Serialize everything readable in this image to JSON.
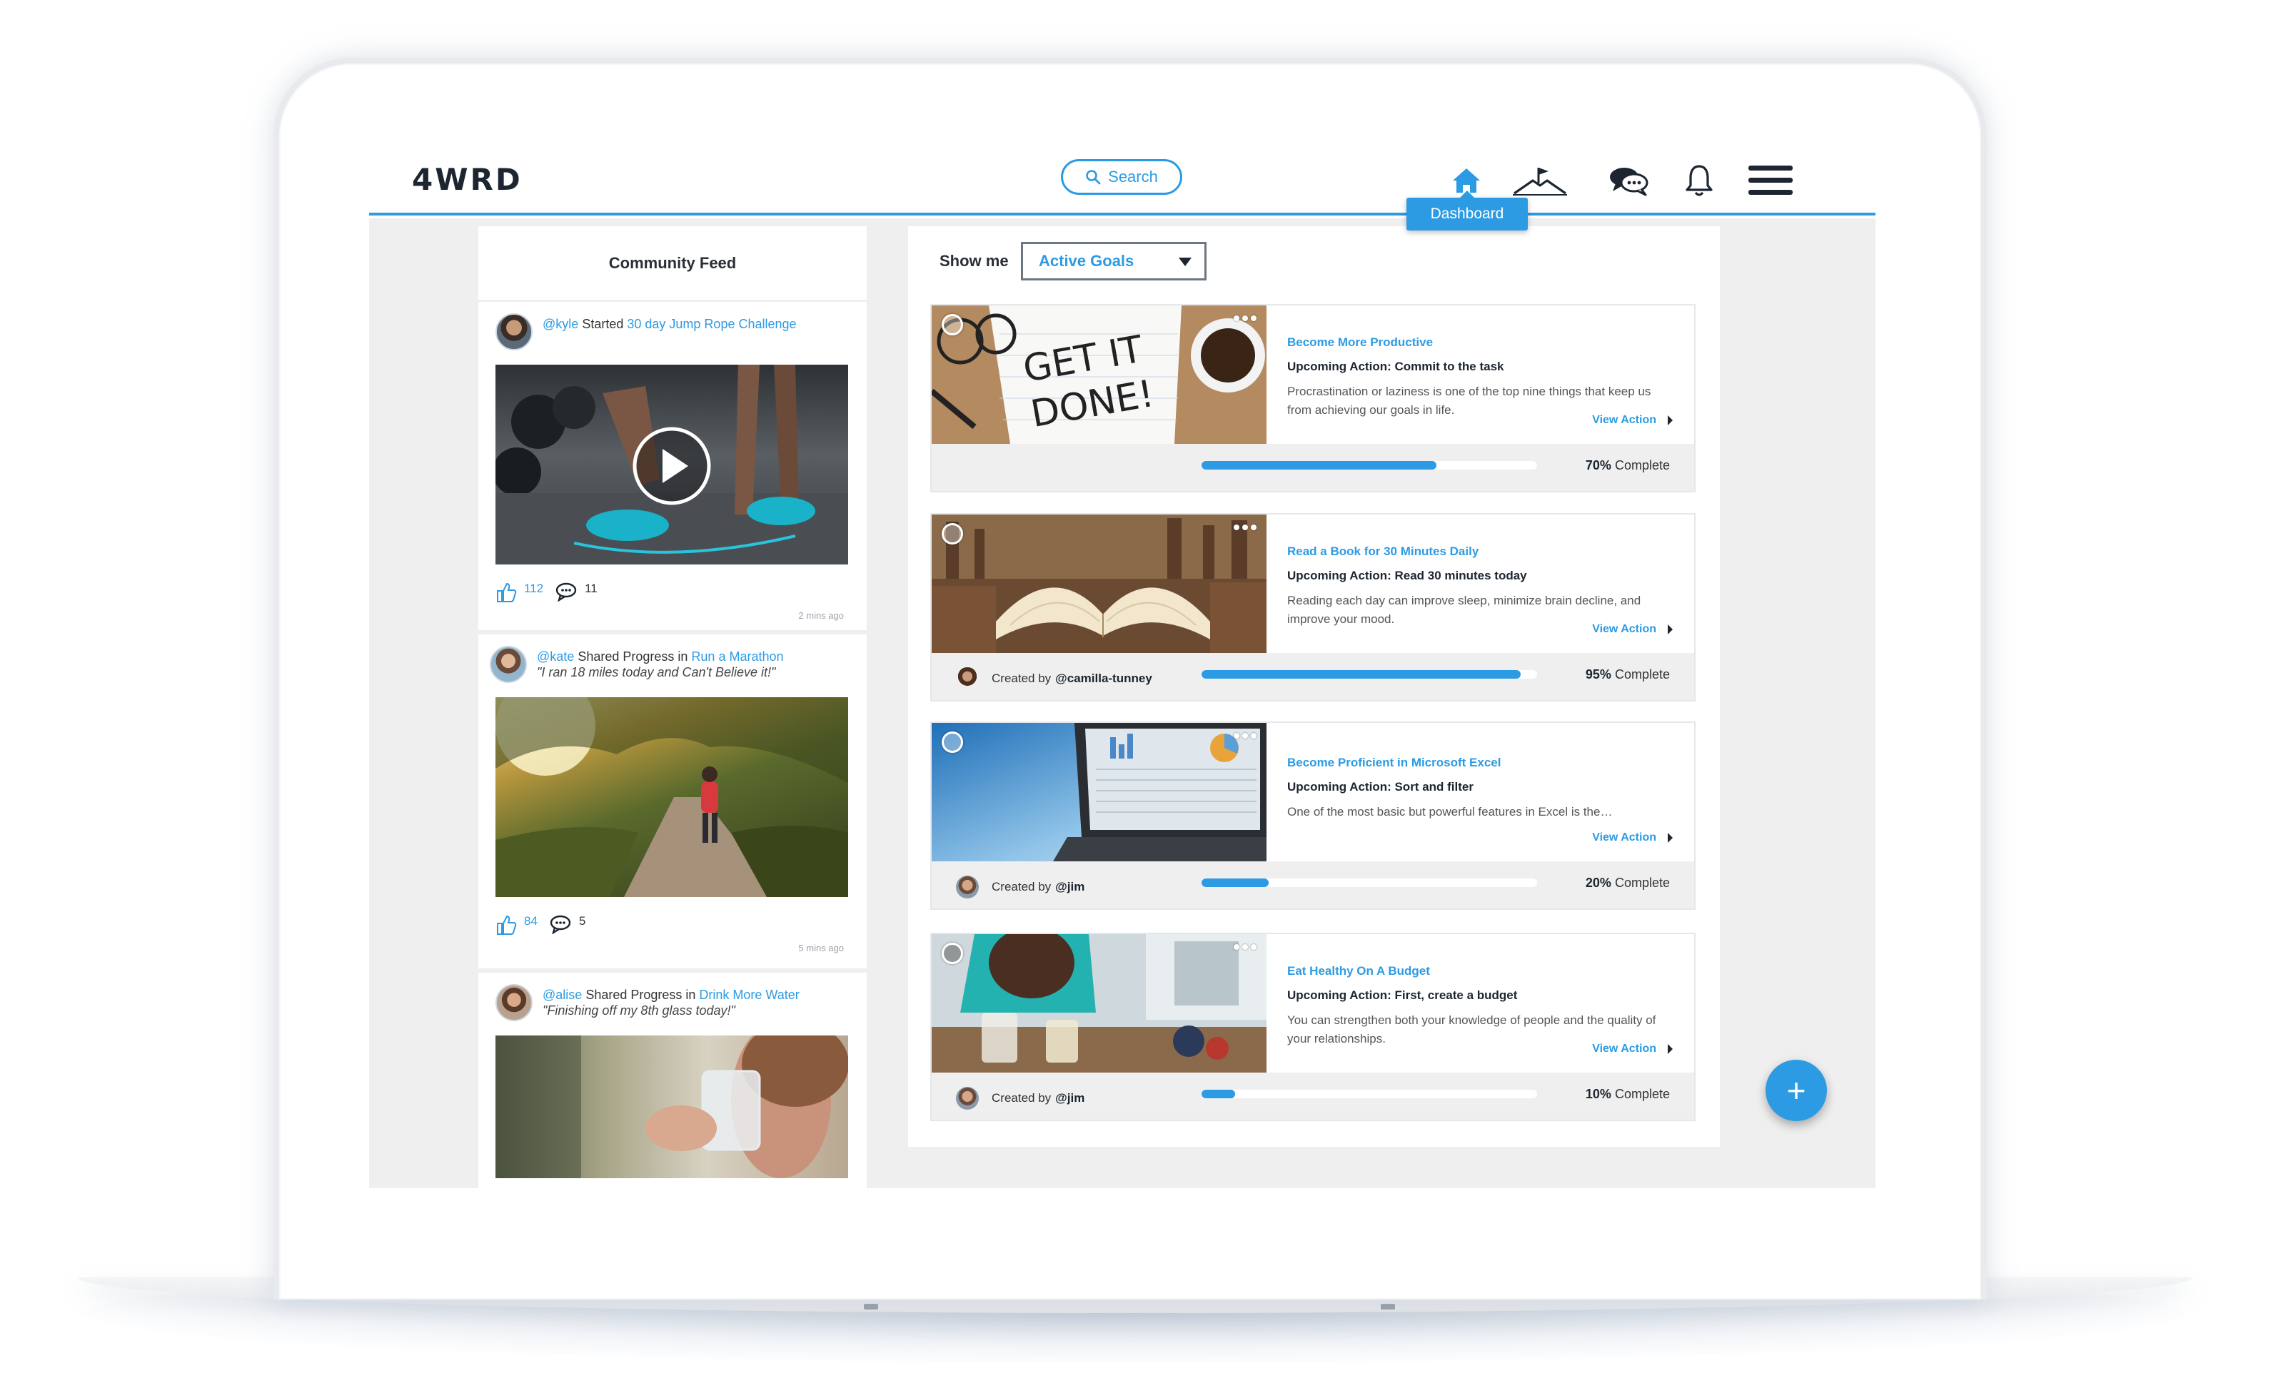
{
  "header": {
    "logo": "4WRD",
    "search_label": "Search",
    "tooltip": "Dashboard",
    "nav": [
      "home-icon",
      "summit-flag-icon",
      "chat-bubbles-icon",
      "bell-icon",
      "hamburger-menu-icon"
    ]
  },
  "feed": {
    "title": "Community Feed",
    "posts": [
      {
        "user": "@kyle",
        "verb": "Started",
        "target": "30 day Jump Rope Challenge",
        "quote": "",
        "likes": "112",
        "comments": "11",
        "time": "2 mins ago"
      },
      {
        "user": "@kate",
        "verb": "Shared Progress in",
        "target": "Run a Marathon",
        "quote": "\"I ran 18 miles today and Can't Believe it!\"",
        "likes": "84",
        "comments": "5",
        "time": "5 mins ago"
      },
      {
        "user": "@alise",
        "verb": "Shared Progress in",
        "target": "Drink More Water",
        "quote": "\"Finishing off my 8th glass today!\"",
        "likes": "",
        "comments": "",
        "time": ""
      }
    ]
  },
  "filter": {
    "label": "Show me",
    "value": "Active Goals"
  },
  "goals": [
    {
      "title": "Become More Productive",
      "action": "Upcoming Action: Commit to the task",
      "desc": "Procrastination or laziness is one of the top nine things that keep us from achieving our goals in life.",
      "view": "View Action",
      "creator_prefix": "",
      "creator": "",
      "progress": 0.7,
      "pct": "70%",
      "complete": "Complete"
    },
    {
      "title": "Read a Book for 30 Minutes Daily",
      "action": "Upcoming Action: Read 30 minutes today",
      "desc": "Reading each day can improve sleep, minimize brain decline, and improve your mood.",
      "view": "View Action",
      "creator_prefix": "Created by",
      "creator": "@camilla-tunney",
      "progress": 0.95,
      "pct": "95%",
      "complete": "Complete"
    },
    {
      "title": "Become Proficient in Microsoft Excel",
      "action": "Upcoming Action: Sort and filter",
      "desc": "One of the most basic but powerful features in Excel is the…",
      "view": "View Action",
      "creator_prefix": "Created by",
      "creator": "@jim",
      "progress": 0.2,
      "pct": "20%",
      "complete": "Complete"
    },
    {
      "title": "Eat Healthy On A Budget",
      "action": "Upcoming Action: First, create a budget",
      "desc": "You can strengthen both your knowledge of people and the quality of your relationships.",
      "view": "View Action",
      "creator_prefix": "Created by",
      "creator": "@jim",
      "progress": 0.1,
      "pct": "10%",
      "complete": "Complete"
    }
  ],
  "fab": "+",
  "colors": {
    "accent": "#2c9be3",
    "panel_bg": "#efefef",
    "text_dark": "#1c2530"
  }
}
